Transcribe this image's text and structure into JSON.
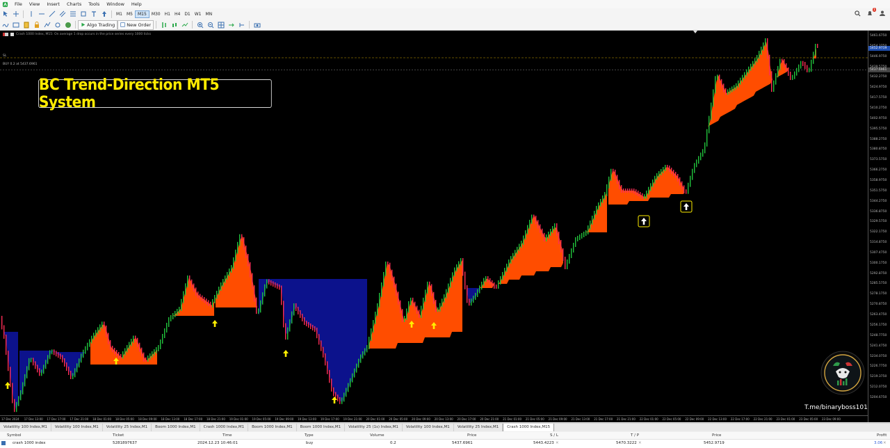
{
  "menu": [
    "File",
    "View",
    "Insert",
    "Charts",
    "Tools",
    "Window",
    "Help"
  ],
  "timeframes": [
    "M1",
    "M5",
    "M15",
    "M30",
    "H1",
    "H4",
    "D1",
    "W1",
    "MN"
  ],
  "active_timeframe": "M15",
  "toolbar2": {
    "algo_trading": "Algo Trading",
    "new_order": "New Order"
  },
  "notification_count": "1",
  "chart": {
    "info_line": "Crash 1000 Index, M15:  On average 1 drop occurs in the price series every 1000 ticks",
    "sl_label": "SL",
    "buy_line": "BUY 0.2 at 5437.6961",
    "banner_title": "BC Trend-Direction MT5 System",
    "watermark": "T.me/binaryboss101",
    "colors": {
      "background": "#000000",
      "bull_cloud": "#ff4d00",
      "bear_cloud": "#0c128c",
      "bull_candle": "#21c23c",
      "bear_candle": "#ff2d55",
      "arrow": "#ffee00",
      "tp_line": "#2ec7b0",
      "sl_line": "#c8a000"
    },
    "price_ticks": [
      "5461.6750",
      "5454.3750",
      "5446.9750",
      "5439.5750",
      "5432.2750",
      "5424.9750",
      "5417.5750",
      "5410.2750",
      "5402.9750",
      "5395.5750",
      "5388.2750",
      "5380.8750",
      "5373.5750",
      "5366.2750",
      "5358.9750",
      "5351.5750",
      "5344.2750",
      "5336.8750",
      "5329.5750",
      "5322.1750",
      "5314.8750",
      "5307.4750",
      "5300.1750",
      "5292.8750",
      "5285.5750",
      "5278.1750",
      "5270.8750",
      "5263.4750",
      "5256.1750",
      "5248.7750",
      "5241.4750",
      "5234.0750",
      "5226.7750",
      "5219.3750",
      "5212.0750",
      "5204.6750"
    ],
    "price_labels": {
      "tp": "5470.3222",
      "current": "5452.9719",
      "entry": "5437.6961"
    },
    "time_ticks": [
      "17 Dec 2024",
      "17 Dec 13:00",
      "17 Dec 17:00",
      "17 Dec 21:00",
      "18 Dec 01:00",
      "18 Dec 05:00",
      "18 Dec 09:00",
      "18 Dec 13:00",
      "18 Dec 17:00",
      "18 Dec 21:00",
      "19 Dec 01:00",
      "19 Dec 05:00",
      "19 Dec 09:00",
      "19 Dec 13:00",
      "19 Dec 17:00",
      "19 Dec 21:00",
      "20 Dec 01:00",
      "20 Dec 05:00",
      "20 Dec 09:00",
      "20 Dec 13:00",
      "20 Dec 17:00",
      "20 Dec 21:00",
      "21 Dec 01:00",
      "21 Dec 05:00",
      "21 Dec 09:00",
      "21 Dec 13:00",
      "21 Dec 17:00",
      "21 Dec 21:00",
      "22 Dec 01:00",
      "22 Dec 05:00",
      "22 Dec 09:00",
      "22 Dec 13:00",
      "22 Dec 17:00",
      "22 Dec 21:00",
      "23 Dec 01:00",
      "23 Dec 05:00",
      "23 Dec 09:00"
    ]
  },
  "symbol_tabs": [
    "Volatility 100 Index,M1",
    "Volatility 100 Index,M1",
    "Volatility 25 Index,M1",
    "Boom 1000 Index,M1",
    "Crash 1000 Index,M1",
    "Boom 1000 Index,M1",
    "Boom 1000 Index,M1",
    "Volatility 25 (1s) Index,M1",
    "Volatility 100 Index,M1",
    "Volatility 25 Index,M1",
    "Crash 1000 Index,M15"
  ],
  "active_tab_index": 10,
  "trade_table": {
    "headers": {
      "symbol": "Symbol",
      "ticket": "Ticket",
      "time": "Time",
      "type": "Type",
      "volume": "Volume",
      "price": "Price",
      "sl": "S / L",
      "tp": "T / P",
      "cur_price": "Price",
      "profit": "Profit"
    },
    "row": {
      "symbol": "crash 1000 index",
      "ticket": "5281897637",
      "time": "2024.12.23 10:46:01",
      "type": "buy",
      "volume": "0.2",
      "price": "5437.6961",
      "sl": "5443.4223",
      "tp": "5470.3222",
      "cur_price": "5452.9719",
      "profit": "3.06"
    }
  }
}
